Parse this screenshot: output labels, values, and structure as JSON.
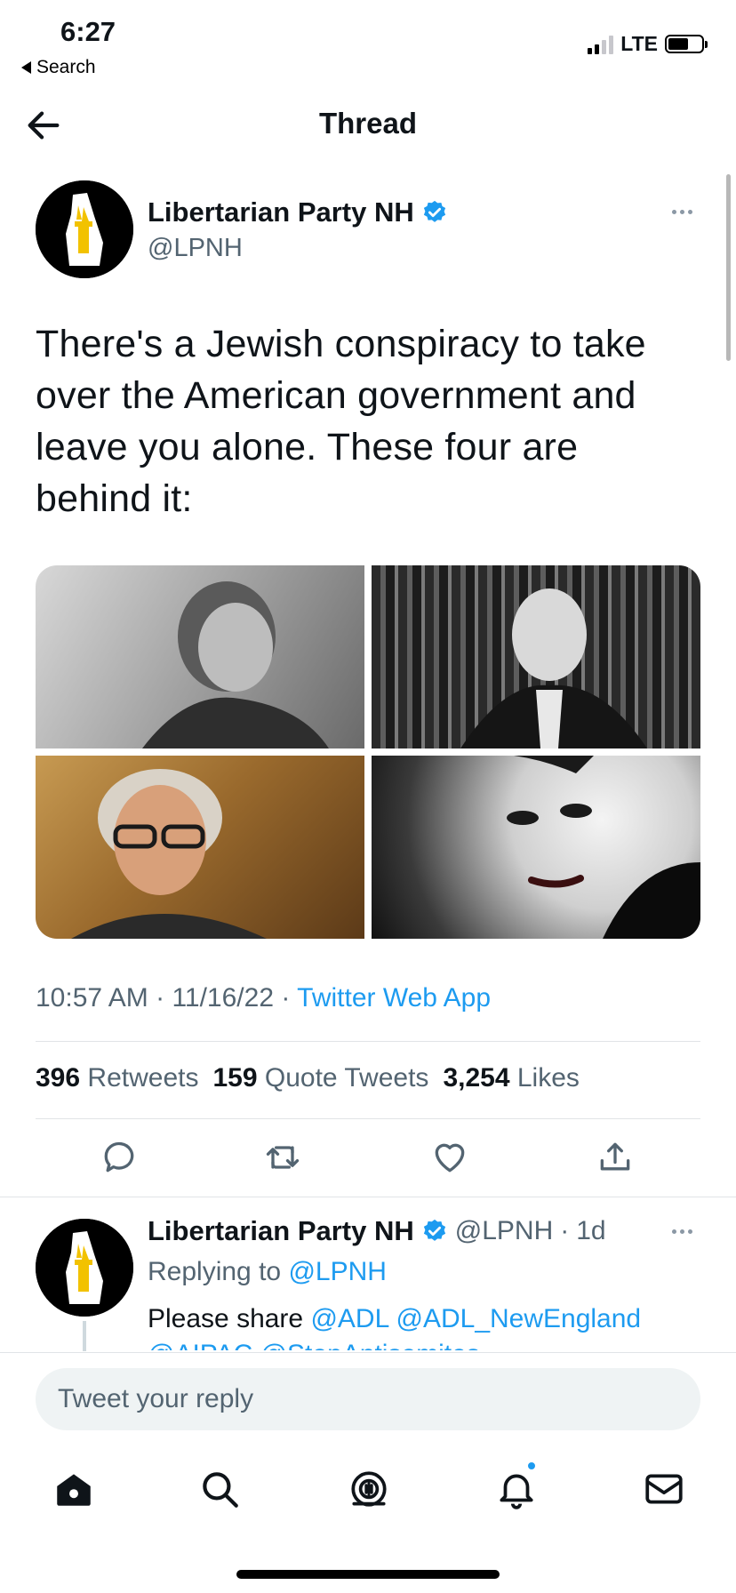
{
  "status_bar": {
    "time": "6:27",
    "back_label": "Search",
    "network": "LTE"
  },
  "header": {
    "title": "Thread"
  },
  "main_tweet": {
    "author_name": "Libertarian Party NH",
    "author_handle": "@LPNH",
    "text": "There's a Jewish conspiracy to take over the American government and leave you alone. These four are behind it:",
    "time": "10:57 AM",
    "date": "11/16/22",
    "separator": "·",
    "source": "Twitter Web App",
    "media_count": 4,
    "stats": {
      "retweets_count": "396",
      "retweets_label": "Retweets",
      "quotes_count": "159",
      "quotes_label": "Quote Tweets",
      "likes_count": "3,254",
      "likes_label": "Likes"
    }
  },
  "reply": {
    "author_name": "Libertarian Party NH",
    "author_handle": "@LPNH",
    "age": "1d",
    "replying_to_label": "Replying to",
    "replying_to_handle": "@LPNH",
    "text_prefix": "Please share",
    "mention_1": "@ADL",
    "mention_2": "@ADL_NewEngland",
    "overflow_text": "@AIPAC @StopAntisemites"
  },
  "composer": {
    "placeholder": "Tweet your reply"
  },
  "colors": {
    "accent": "#1d9bf0",
    "muted": "#536471",
    "text": "#0f1419"
  },
  "icons": {
    "back": "arrow-left-icon",
    "verified": "verified-badge-icon",
    "more": "more-horizontal-icon",
    "reply": "reply-icon",
    "retweet": "retweet-icon",
    "like": "heart-icon",
    "share": "share-icon",
    "home": "home-icon",
    "search": "search-icon",
    "spaces": "spaces-icon",
    "notifications": "bell-icon",
    "messages": "mail-icon"
  }
}
